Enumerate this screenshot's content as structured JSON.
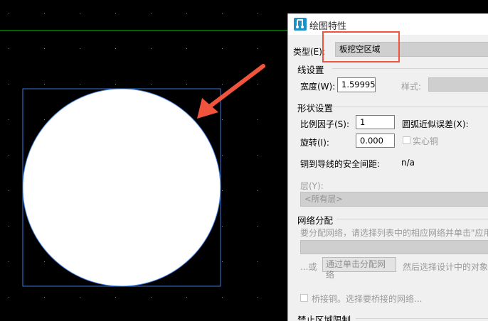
{
  "dialog": {
    "title": "绘图特性",
    "type_label": "类型(E):",
    "type_value": "板挖空区域",
    "line_settings": {
      "header": "线设置",
      "width_label": "宽度(W):",
      "width_value": "1.59995",
      "style_label": "样式:"
    },
    "shape_settings": {
      "header": "形状设置",
      "scale_label": "比例因子(S):",
      "scale_value": "1",
      "arc_label": "圆弧近似误差(X):",
      "rotation_label": "旋转(I):",
      "rotation_value": "0.000",
      "solid_copper_label": "实心铜",
      "clearance_label": "铜到导线的安全间距:",
      "clearance_value": "n/a"
    },
    "layer": {
      "label": "层(Y):",
      "value": "<所有层>"
    },
    "net_assign": {
      "header": "网络分配",
      "hint": "要分配网络，请选择列表中的相应网络并单击\"应用",
      "or_text": "...或",
      "assign_button": "通过单击分配网络",
      "then_text": "然后选择设计中的对象",
      "bridge_label": "桥接铜。选择要桥接的网络..."
    },
    "restriction_header": "禁止区域限制"
  },
  "colors": {
    "canvas_bg": "#000000",
    "guide_line": "#00c800",
    "circle_fill": "#ffffff",
    "selection_box": "#3a78e0",
    "annotation": "#f0543c"
  }
}
